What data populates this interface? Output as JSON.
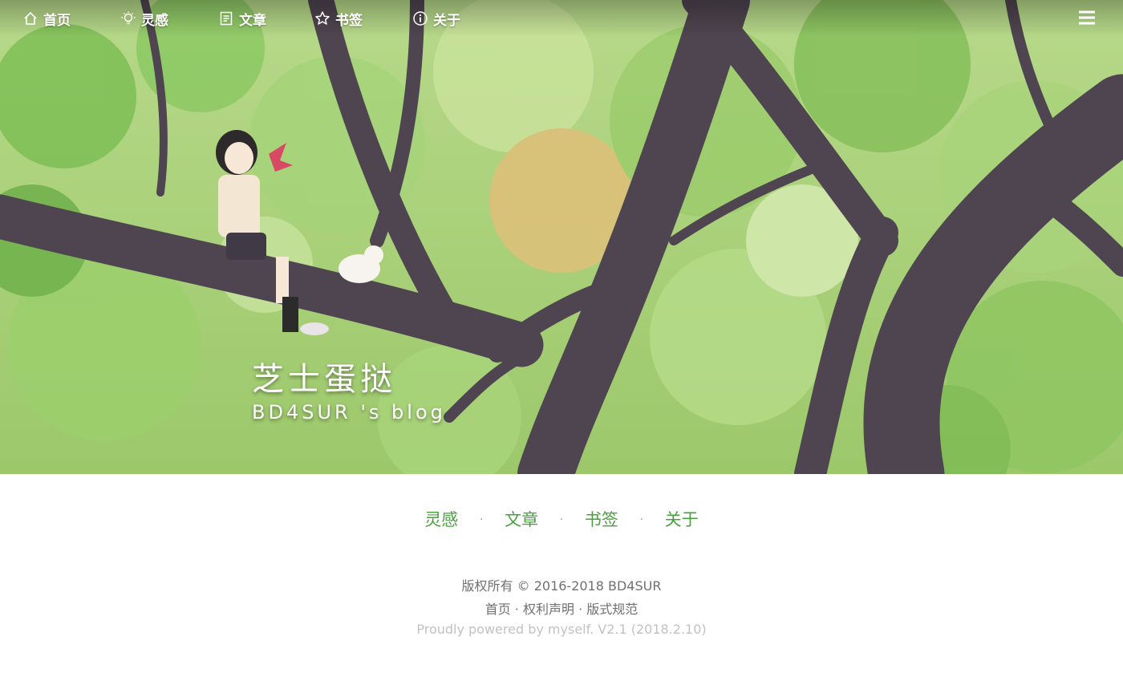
{
  "header": {
    "nav": [
      {
        "label": "首页",
        "icon": "home-icon"
      },
      {
        "label": "灵感",
        "icon": "lightbulb-icon"
      },
      {
        "label": "文章",
        "icon": "document-icon"
      },
      {
        "label": "书签",
        "icon": "star-icon"
      },
      {
        "label": "关于",
        "icon": "info-icon"
      }
    ],
    "menu_icon": "hamburger-menu-icon"
  },
  "hero": {
    "title": "芝士蛋挞",
    "subtitle": "BD4SUR 's blog"
  },
  "quick_nav": {
    "items": [
      "灵感",
      "文章",
      "书签",
      "关于"
    ],
    "separator": "·"
  },
  "footer": {
    "copyright": "版权所有 © 2016-2018 BD4SUR",
    "links": [
      "首页",
      "权利声明",
      "版式规范"
    ],
    "link_separator": " · ",
    "powered_by": "Proudly powered by myself. V2.1 (2018.2.10)"
  },
  "colors": {
    "accent": "#4aa040",
    "footer_text": "#707070",
    "footer_muted": "#c2c2c2"
  }
}
